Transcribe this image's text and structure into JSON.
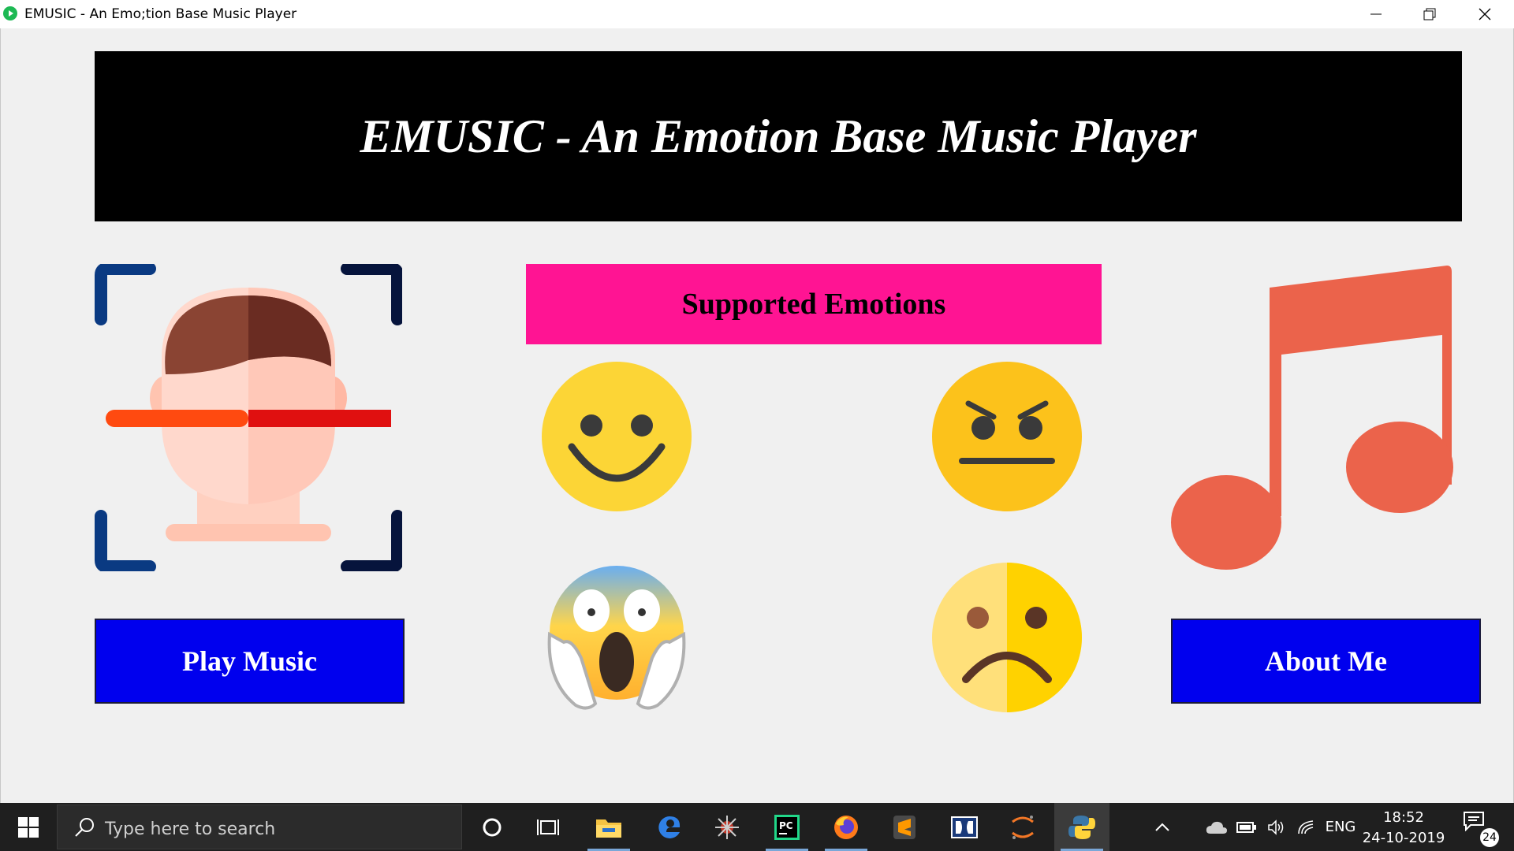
{
  "window": {
    "title": "EMUSIC - An Emo;tion Base Music Player",
    "controls": [
      "minimize-icon",
      "restore-icon",
      "close-icon"
    ]
  },
  "banner": {
    "title": "EMUSIC - An Emotion Base Music Player"
  },
  "emotions": {
    "header": "Supported Emotions",
    "items": [
      "happy-emoji-icon",
      "angry-emoji-icon",
      "fear-emoji-icon",
      "sad-emoji-icon"
    ]
  },
  "buttons": {
    "play": "Play Music",
    "about": "About Me"
  },
  "colors": {
    "banner_bg": "#000000",
    "emotions_header_bg": "#ff1493",
    "button_bg": "#0000ee",
    "note_color": "#eb634b"
  },
  "taskbar": {
    "search_placeholder": "Type here to search",
    "pinned": [
      "cortana-icon",
      "task-view-icon",
      "file-explorer-icon",
      "edge-icon",
      "spider-app-icon",
      "pycharm-icon",
      "firefox-icon",
      "sublime-text-icon",
      "dolby-icon",
      "jupyter-icon",
      "python-icon"
    ],
    "tray": {
      "language": "ENG",
      "time": "18:52",
      "date": "24-10-2019",
      "notifications": "24"
    }
  }
}
